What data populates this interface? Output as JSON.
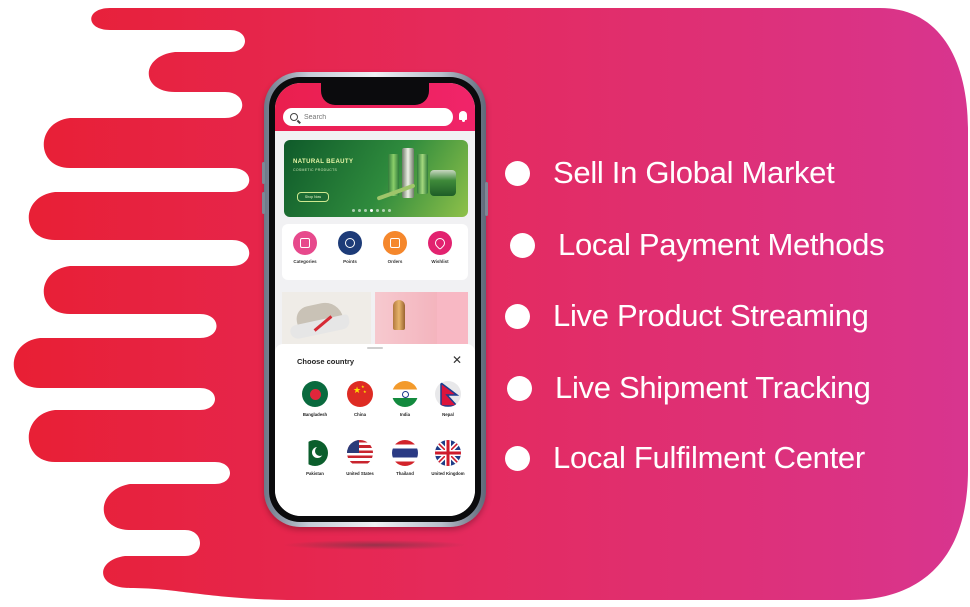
{
  "colors": {
    "gradient_start": "#e9213e",
    "gradient_end": "#d9348f",
    "header": "#ee2157",
    "banner": "#1f7a35"
  },
  "features": [
    "Sell In Global Market",
    "Local Payment Methods",
    "Live Product Streaming",
    "Live Shipment Tracking",
    "Local Fulfilment Center"
  ],
  "app": {
    "search_placeholder": "Search",
    "banner": {
      "title": "NATURAL BEAUTY",
      "subtitle": "COSMETIC PRODUCTS",
      "button": "Shop Now"
    },
    "quick_actions": [
      {
        "label": "Categories",
        "icon": "list-icon",
        "color": "#e7498c"
      },
      {
        "label": "Points",
        "icon": "coin-icon",
        "color": "#1d3b78"
      },
      {
        "label": "Orders",
        "icon": "bag-icon",
        "color": "#f5872c"
      },
      {
        "label": "Wishlist",
        "icon": "heart-icon",
        "color": "#e2226f"
      }
    ],
    "country_sheet": {
      "title": "Choose country",
      "close_icon": "close-icon",
      "countries": [
        "Bangladesh",
        "China",
        "India",
        "Nepal",
        "Pakistan",
        "United States",
        "Thailand",
        "United Kingdom"
      ]
    }
  }
}
